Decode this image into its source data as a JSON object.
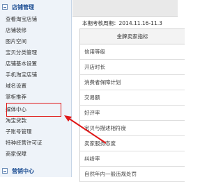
{
  "sidebar": {
    "shop_section": "店铺管理",
    "items": [
      "查看淘宝店铺",
      "店铺装修",
      "图片空间",
      "宝贝分类管理",
      "店铺基本设置",
      "手机淘宝店铺",
      "域名设置",
      "掌柜推荐",
      "媒体中心",
      "淘宝贷款",
      "子账号管理",
      "特种经营许可证",
      "商家保障"
    ],
    "marketing_section": "营销中心"
  },
  "content": {
    "period_text": "本期考核周期：2014.11.16-11.3",
    "table_header": "金牌卖家指标",
    "rows": [
      "信用等级",
      "开店时长",
      "消费者保障计划",
      "交易额",
      "好评率",
      "宝贝与描述相符度",
      "卖家服务态度",
      "纠纷率",
      "自然年内一般违规处罚"
    ]
  },
  "colors": {
    "highlight": "#e01818",
    "sidebar_bg": "#eef3f9",
    "section_title": "#1e4f94"
  }
}
